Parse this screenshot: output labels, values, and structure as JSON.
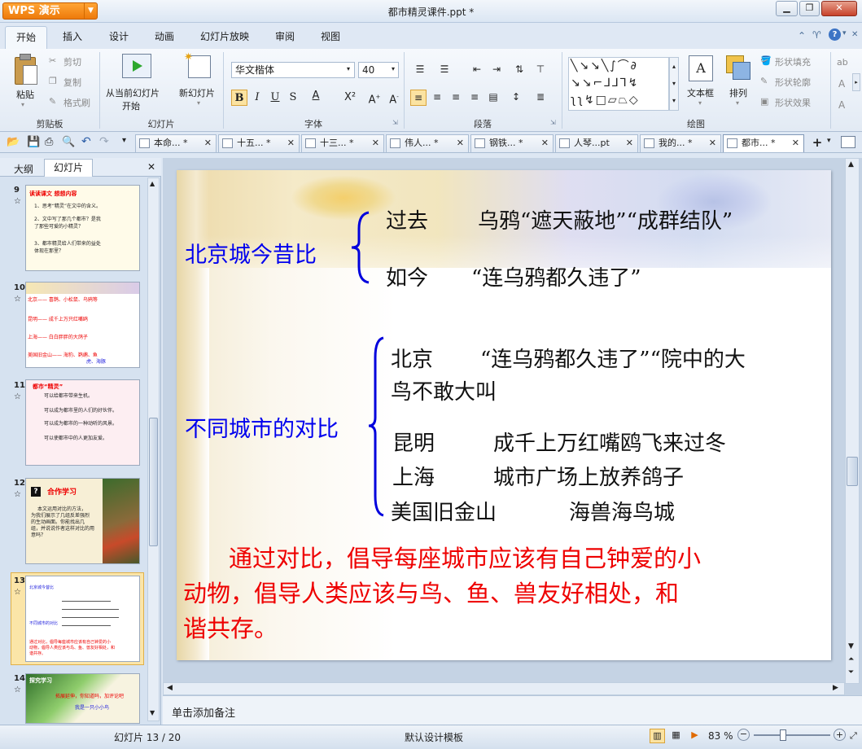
{
  "app": {
    "logo": "WPS 演示",
    "window_title": "都市精灵课件.ppt *"
  },
  "menu": {
    "tabs": [
      "开始",
      "插入",
      "设计",
      "动画",
      "幻灯片放映",
      "审阅",
      "视图"
    ]
  },
  "ribbon": {
    "clipboard": {
      "paste": "粘贴",
      "cut": "剪切",
      "copy": "复制",
      "format_painter": "格式刷",
      "group": "剪贴板"
    },
    "slides": {
      "from_current_1": "从当前幻灯片",
      "from_current_2": "开始",
      "new_slide": "新幻灯片",
      "group": "幻灯片"
    },
    "font": {
      "name": "华文楷体",
      "size": "40",
      "group": "字体"
    },
    "paragraph": {
      "group": "段落"
    },
    "drawing": {
      "textbox": "文本框",
      "arrange": "排列",
      "shape_fill": "形状填充",
      "shape_outline": "形状轮廓",
      "shape_effect": "形状效果",
      "group": "绘图"
    }
  },
  "doc_tabs": [
    "本命...  *",
    "十五...  *",
    "十三...  *",
    "伟人...  *",
    "钢铁...  *",
    "人琴...pt",
    "我的...  *",
    "都市...  *"
  ],
  "left_panel": {
    "tab_outline": "大纲",
    "tab_slides": "幻灯片",
    "thumbs": [
      {
        "num": "9",
        "lines": [
          "读读课文  想想内容",
          "1、思考“精灵”在文中的含义。",
          "2、文中写了那几个都市？是我",
          "了那些可爱的小精灵？",
          "3、都市精灵给人们带来的益处",
          "体现在那里？"
        ]
      },
      {
        "num": "10",
        "lines": [
          "北京——  喜鹊、小松鼠、乌鸦等",
          "昆明——  成千上万只红嘴鸥",
          "上海——  白白胖胖的大鸽子",
          "美国旧金山——  海豹、鹈鹕、鱼",
          "虎、海豚"
        ]
      },
      {
        "num": "11",
        "lines": [
          "都市“精灵”",
          "可以给都市带来生机。",
          "可以成为都市里的人们的好伙伴。",
          "可以成为都市的一种动听的风景。",
          "可以使都市中的人更加友爱。"
        ]
      },
      {
        "num": "12",
        "lines": [
          "合作学习",
          "本文运用对比的方法，",
          "为我们展示了几组反差强烈",
          "的生动画面。你能找出几",
          "组，并说说作者这样对比的用",
          "意吗？"
        ]
      },
      {
        "num": "13",
        "lines": [
          "北京城今昔比",
          "不同城市的对比",
          "通过对比，倡导每座城市应该有自己钟爱的小",
          "动物，倡导人类应该与鸟、鱼、兽友好相处，和",
          "谐共存。"
        ]
      },
      {
        "num": "14",
        "lines": [
          "探究学习",
          "拓展延伸，你知道吗，加评论吧",
          "我是一只小小鸟"
        ]
      }
    ]
  },
  "slide": {
    "heading1": "北京城今昔比",
    "past_label": "过去",
    "past_text": "乌鸦“遮天蔽地”“成群结队”",
    "now_label": "如今",
    "now_text": "“连乌鸦都久违了”",
    "heading2": "不同城市的对比",
    "beijing_label": "北京",
    "beijing_text": "“连乌鸦都久违了”“院中的大",
    "beijing_text2": "鸟不敢大叫",
    "kunming_label": "昆明",
    "kunming_text": "成千上万红嘴鸥飞来过冬",
    "shanghai_label": "上海",
    "shanghai_text": "城市广场上放养鸽子",
    "sf_label": "美国旧金山",
    "sf_text": "海兽海鸟城",
    "conclusion1": "通过对比，倡导每座城市应该有自己钟爱的小",
    "conclusion2": "动物，倡导人类应该与鸟、鱼、兽友好相处，和",
    "conclusion3": "谐共存。"
  },
  "notes": {
    "placeholder": "单击添加备注"
  },
  "status": {
    "slide_counter": "幻灯片 13 / 20",
    "template": "默认设计模板",
    "zoom": "83 %"
  },
  "colors": {
    "heading_blue": "#0000ee",
    "conclusion_red": "#ee0000",
    "accent_orange": "#f08a1c"
  }
}
